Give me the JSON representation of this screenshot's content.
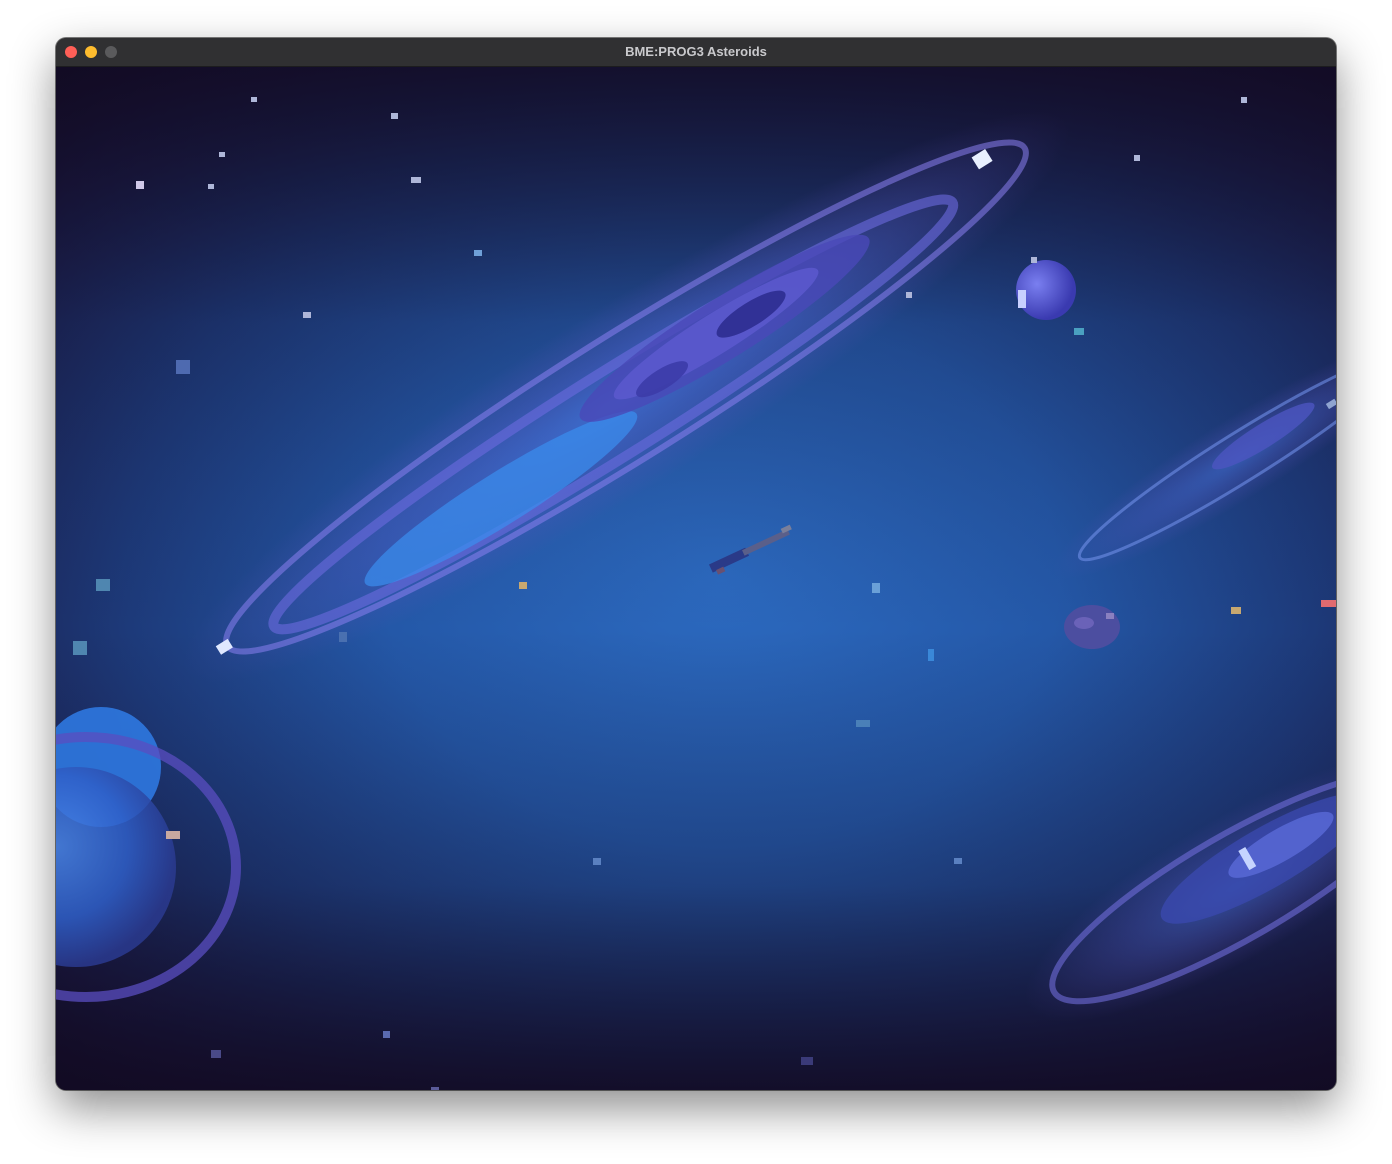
{
  "window": {
    "title": "BME:PROG3 Asteroids",
    "buttons": [
      "close",
      "minimize",
      "maximize"
    ]
  },
  "scene": {
    "background": "space-nebula",
    "objects": [
      "galaxy-upper",
      "galaxy-right",
      "galaxy-lower-right",
      "ringed-planet-left",
      "moon",
      "player-ship",
      "asteroid",
      "laser-bolt"
    ]
  },
  "colors": {
    "space_dark": "#120c22",
    "space_blue": "#2a63b8",
    "galaxy_glow": "#7b6fe0",
    "close": "#ff5f57",
    "minimize": "#febc2e",
    "maximize": "#5a5a5c"
  }
}
